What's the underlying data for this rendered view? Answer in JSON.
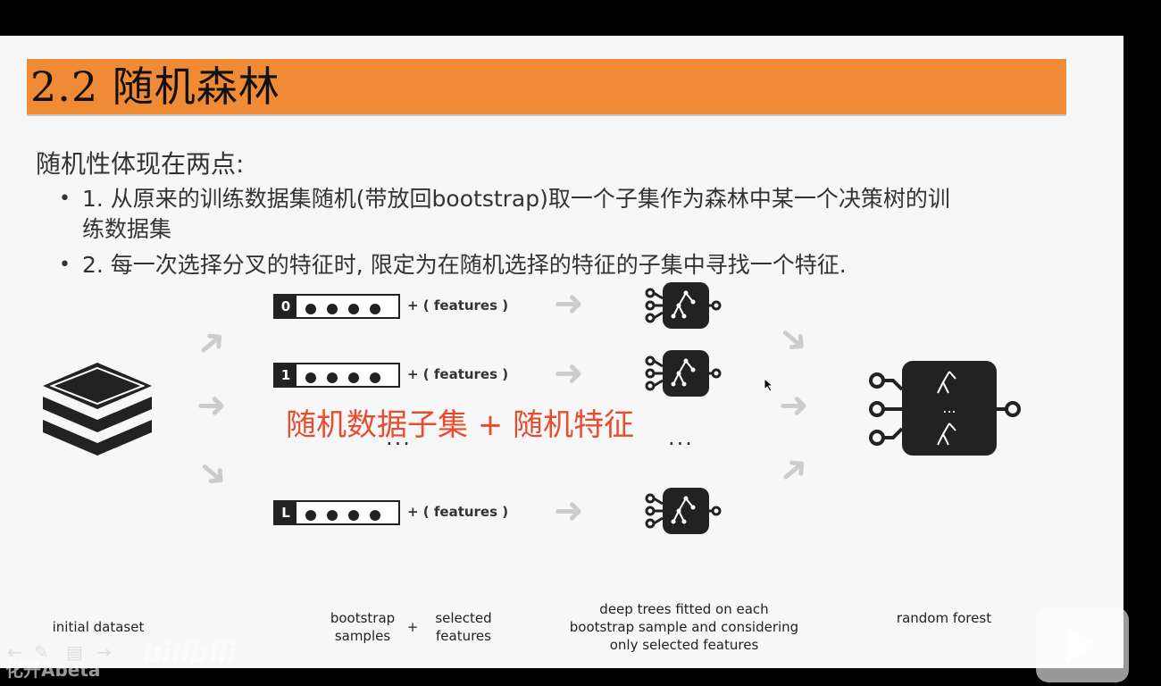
{
  "slide": {
    "title": "2.2 随机森林",
    "heading": "随机性体现在两点:",
    "bullets": [
      {
        "line1": "1. 从原来的训练数据集随机(带放回bootstrap)取一个子集作为森林中某一个决策树的训",
        "line2": "练数据集"
      },
      {
        "line1": "2. 每一次选择分叉的特征时, 限定为在随机选择的特征的子集中寻找一个特征."
      }
    ],
    "rows": [
      {
        "index": "0",
        "plus_features": "+ ( features )"
      },
      {
        "index": "1",
        "plus_features": "+ ( features )"
      },
      {
        "index": "L",
        "plus_features": "+ ( features )"
      }
    ],
    "ellipsis": "...",
    "tree_ellipsis": "...",
    "overlay_text": "随机数据子集 + 随机特征",
    "captions": {
      "initial_dataset": "initial dataset",
      "bootstrap_samples": "bootstrap\nsamples",
      "plus": "+",
      "selected_features": "selected\nfeatures",
      "deep_trees": "deep trees fitted on each\nbootstrap sample and considering\nonly selected features",
      "random_forest": "random forest"
    },
    "forest_dots": "..."
  },
  "player": {
    "watermark": "bilibili",
    "aux_watermark": "化开Abeta",
    "tools": [
      "back-arrow-icon",
      "pen-icon",
      "notes-icon",
      "forward-arrow-icon"
    ]
  },
  "colors": {
    "title_bar": "#f08a35",
    "overlay_red": "#e84c2f",
    "dark": "#222222"
  }
}
